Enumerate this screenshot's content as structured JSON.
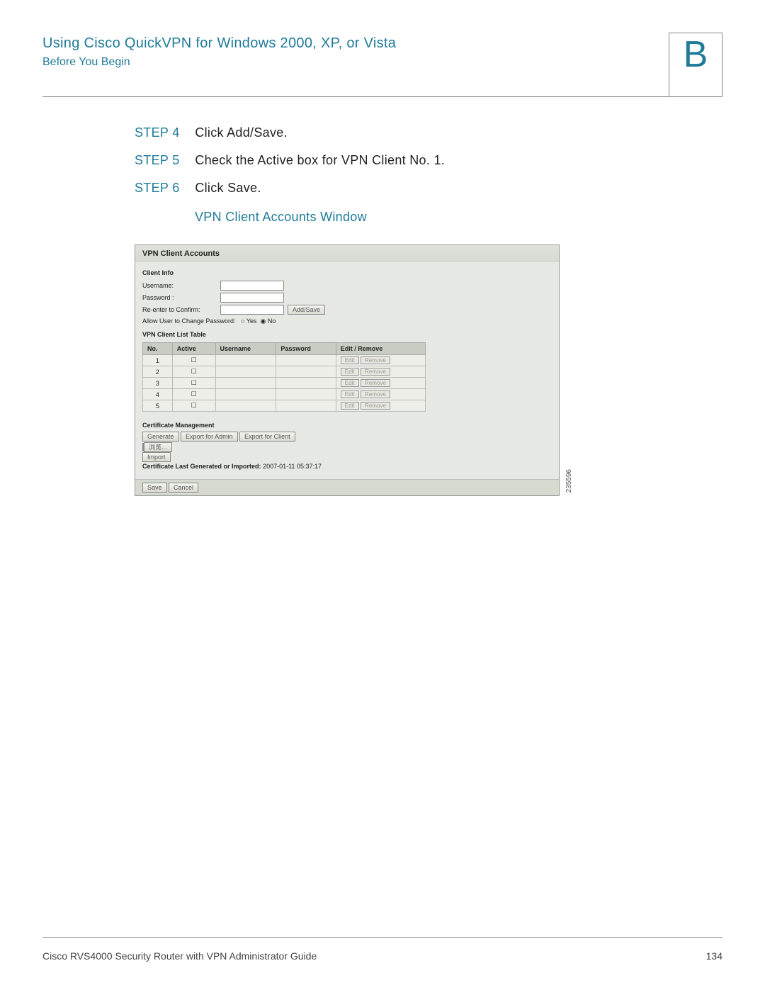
{
  "header": {
    "title": "Using Cisco QuickVPN for Windows 2000, XP, or Vista",
    "subtitle": "Before You Begin",
    "appendix": "B"
  },
  "steps": [
    {
      "label": "STEP 4",
      "text": "Click Add/Save."
    },
    {
      "label": "STEP 5",
      "text": "Check the Active box for VPN Client No. 1."
    },
    {
      "label": "STEP 6",
      "text": "Click Save."
    }
  ],
  "caption": "VPN Client Accounts Window",
  "shot": {
    "title": "VPN Client Accounts",
    "client_info_label": "Client Info",
    "username_label": "Username:",
    "password_label": "Password :",
    "reenter_label": "Re-enter to Confirm:",
    "addsave": "Add/Save",
    "allow_change_label": "Allow User to Change Password:",
    "yes": "Yes",
    "no": "No",
    "list_table_label": "VPN Client List Table",
    "cols": {
      "no": "No.",
      "active": "Active",
      "username": "Username",
      "password": "Password",
      "editremove": "Edit / Remove"
    },
    "rows": [
      "1",
      "2",
      "3",
      "4",
      "5"
    ],
    "edit": "Edit",
    "remove": "Remove",
    "cert_label": "Certificate Management",
    "generate": "Generate",
    "export_admin": "Export for Admin",
    "export_client": "Export for Client",
    "browse": "浏览...",
    "import": "Import",
    "cert_last_label": "Certificate Last Generated or Imported:",
    "cert_last_value": "2007-01-11 05:37:17",
    "save": "Save",
    "cancel": "Cancel",
    "sidecode": "235596"
  },
  "footer": {
    "left": "Cisco RVS4000 Security Router with VPN Administrator Guide",
    "page": "134"
  }
}
